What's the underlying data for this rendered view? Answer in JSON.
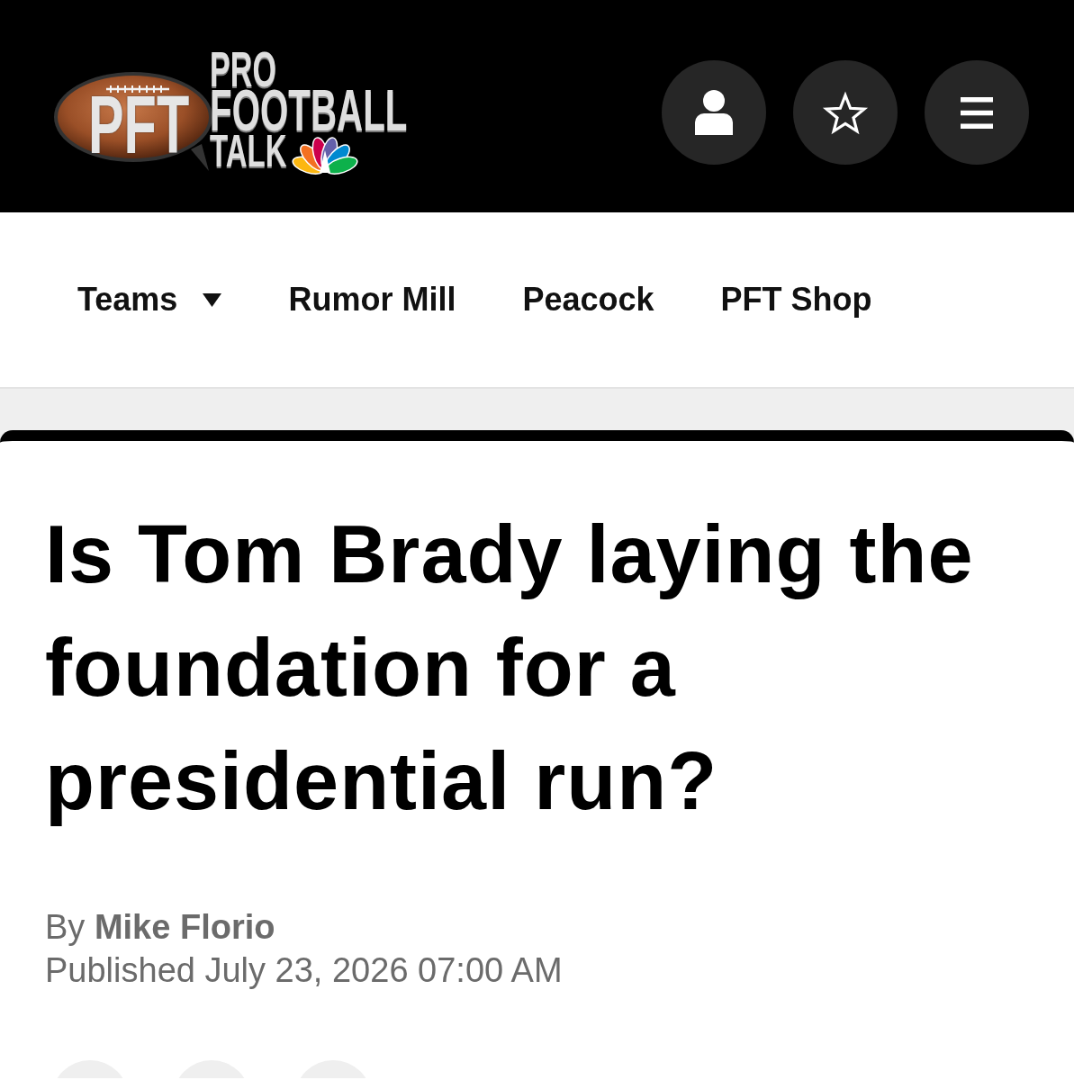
{
  "header": {
    "logo": {
      "badge": "PFT",
      "wordmark": [
        "PRO",
        "FOOTBALL",
        "TALK"
      ]
    },
    "buttons": [
      {
        "kind": "account"
      },
      {
        "kind": "favorites"
      },
      {
        "kind": "menu"
      }
    ]
  },
  "nav": {
    "items": [
      {
        "label": "Teams",
        "dropdown": true
      },
      {
        "label": "Rumor Mill",
        "dropdown": false
      },
      {
        "label": "Peacock",
        "dropdown": false
      },
      {
        "label": "PFT Shop",
        "dropdown": false
      }
    ]
  },
  "article": {
    "headline": "Is Tom Brady laying the foundation for a presidential run?",
    "byline": "By **Mike Florio**",
    "published": "Published July 23, 2026 07:00 AM"
  }
}
